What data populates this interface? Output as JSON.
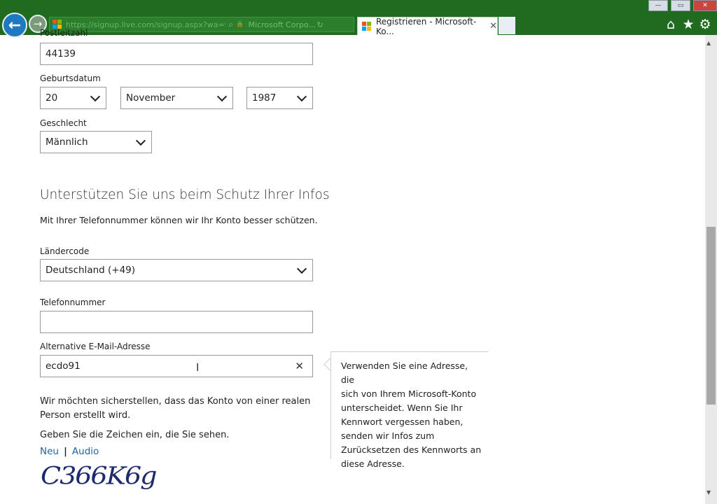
{
  "browser": {
    "url": "https://signup.live.com/signup.aspx?wa=w",
    "tab_inactive": "Microsoft Corpo...",
    "tab_active_title": "Registrieren - Microsoft-Ko...",
    "tab_close_glyph": "✕",
    "back_glyph": "←",
    "forward_glyph": "→",
    "search_glyph": "⌕",
    "lock_glyph": "🔒",
    "refresh_glyph": "↻",
    "home_glyph": "⌂",
    "favorites_glyph": "★",
    "tools_glyph": "⚙",
    "win_min": "—",
    "win_max": "▭",
    "win_close": "✕"
  },
  "form": {
    "postal_code_label": "Postleitzahl",
    "postal_code_value": "44139",
    "birthdate_label": "Geburtsdatum",
    "birth_day": "20",
    "birth_month": "November",
    "birth_year": "1987",
    "gender_label": "Geschlecht",
    "gender_value": "Männlich"
  },
  "security": {
    "heading": "Unterstützen Sie uns beim Schutz Ihrer Infos",
    "description": "Mit Ihrer Telefonnummer können wir Ihr Konto besser schützen.",
    "country_code_label": "Ländercode",
    "country_code_value": "Deutschland (+49)",
    "phone_label": "Telefonnummer",
    "phone_value": "",
    "alt_email_label": "Alternative E-Mail-Adresse",
    "alt_email_value": "ecdo91",
    "clear_glyph": "✕"
  },
  "tooltip": {
    "lines": [
      "Verwenden Sie eine Adresse, die",
      "sich von Ihrem Microsoft-Konto",
      "unterscheidet. Wenn Sie Ihr",
      "Kennwort vergessen haben,",
      "senden wir Infos zum",
      "Zurücksetzen des Kennworts an",
      "diese Adresse."
    ]
  },
  "captcha": {
    "intro_line1": "Wir möchten sicherstellen, dass das Konto von einer realen",
    "intro_line2": "Person erstellt wird.",
    "instruction": "Geben Sie die Zeichen ein, die Sie sehen.",
    "new_link": "Neu",
    "separator": "|",
    "audio_link": "Audio",
    "image_text": "C366K6g"
  },
  "colors": {
    "chrome_bg": "#1f6b1f",
    "link": "#1a64a8",
    "ms_red": "#f25022",
    "ms_green": "#7fba00",
    "ms_blue": "#00a4ef",
    "ms_yellow": "#ffb900",
    "captcha_ink": "#1e2a6e"
  }
}
